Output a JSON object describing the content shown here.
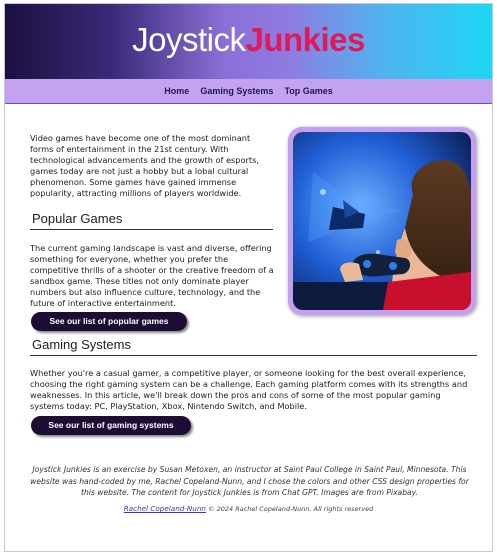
{
  "header": {
    "logo_word1": "Joystick",
    "logo_word2": "Junkies"
  },
  "nav": {
    "items": [
      "Home",
      "Gaming Systems",
      "Top Games"
    ]
  },
  "intro": {
    "text": "Video games have become one of the most dominant forms of entertainment in the 21st century. With technological advancements and the growth of esports, games today are not just a hobby but a lobal cultural phenomenon. Some games have gained immense popularity, attracting millions of players worldwide."
  },
  "popular_games": {
    "heading": "Popular Games",
    "text": "The current gaming landscape is vast and diverse, offering something for everyone, whether you prefer the competitive thrills of a shooter or the creative freedom of a sandbox game. These titles not only dominate player numbers but also influence culture, technology, and the future of interactive entertainment.",
    "button_label": "See our list of popular games"
  },
  "gaming_systems": {
    "heading": "Gaming Systems",
    "text": "Whether you're a casual gamer, a competitive player, or someone looking for the best overall experience, choosing the right gaming system can be a challenge. Each gaming platform comes with its strengths and weaknesses. In this article, we'll break down the pros and cons of some of the most popular gaming systems today: PC, PlayStation, Xbox, Nintendo Switch, and Mobile.",
    "button_label": "See our list of gaming systems"
  },
  "footer": {
    "text": "Joystick Junkies is an exercise by Susan Metoxen, an instructor at Saint Paul College in Saint Paul, Minnesota. This website was hand-coded by me, Rachel Copeland-Nunn, and I chose the colors and other CSS design properties for this website. The content for Joystick Junkies is from Chat GPT. Images are from Pixabay.",
    "author_link": "Rachel Copeland-Nunn",
    "copyright": "© 2024 Rachel Copeland-Nunn. All rights reserved"
  },
  "colors": {
    "nav_bg": "#c4a2f2",
    "button_bg": "#1d0c33",
    "logo_accent": "#e0195a",
    "photo_frame": "#c49ff0"
  }
}
